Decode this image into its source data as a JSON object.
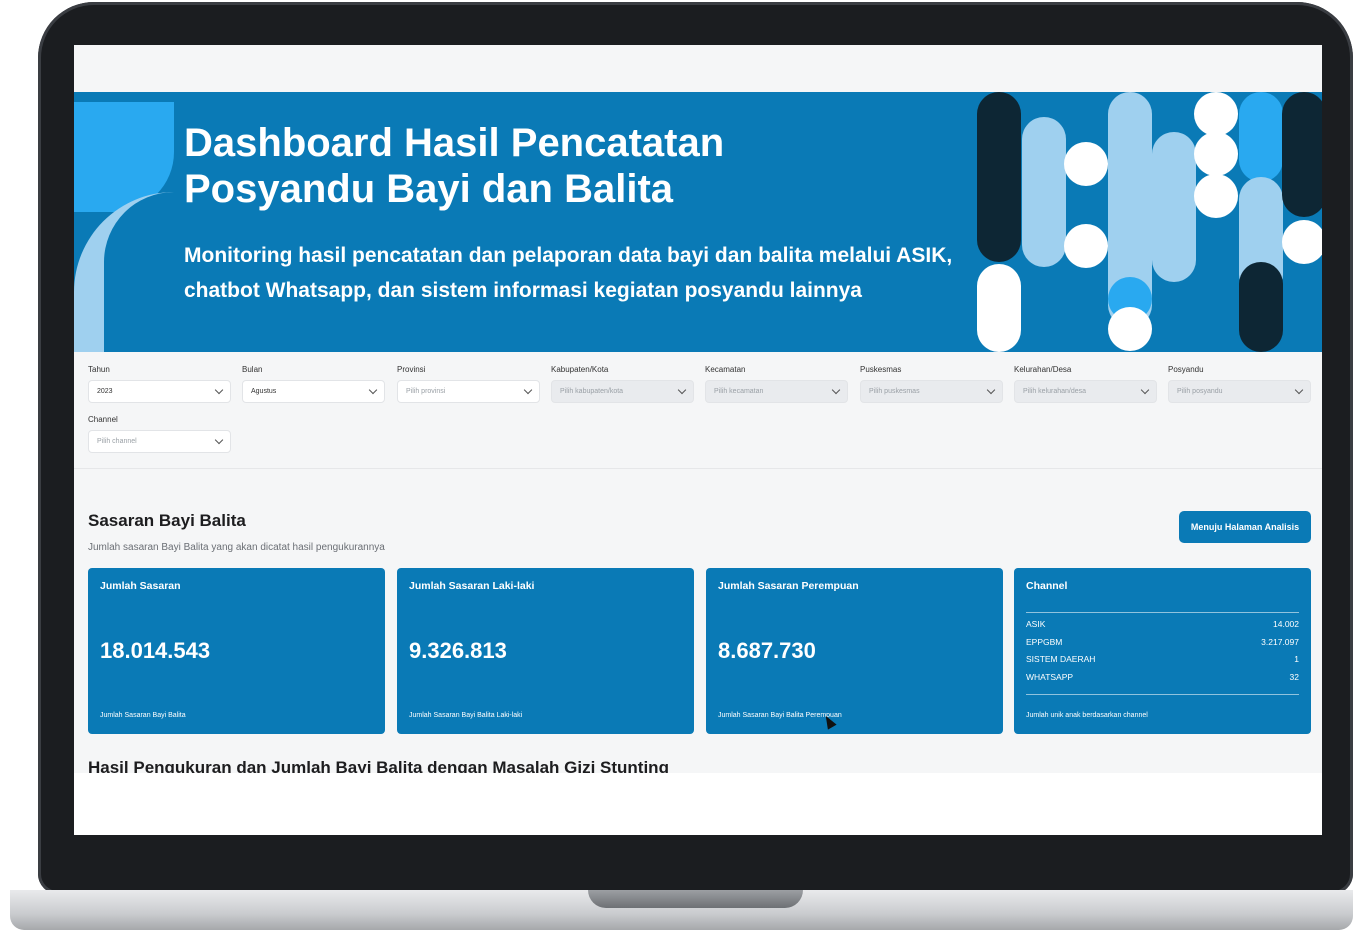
{
  "hero": {
    "title_line1": "Dashboard Hasil Pencatatan",
    "title_line2": "Posyandu Bayi dan Balita",
    "subtitle": "Monitoring hasil pencatatan dan pelaporan data bayi dan balita melalui ASIK, chatbot Whatsapp, dan sistem informasi kegiatan posyandu lainnya"
  },
  "filters": [
    {
      "label": "Tahun",
      "value": "2023",
      "placeholder": ""
    },
    {
      "label": "Bulan",
      "value": "Agustus",
      "placeholder": ""
    },
    {
      "label": "Provinsi",
      "value": "",
      "placeholder": "Pilih provinsi"
    },
    {
      "label": "Kabupaten/Kota",
      "value": "",
      "placeholder": "Pilih kabupaten/kota"
    },
    {
      "label": "Kecamatan",
      "value": "",
      "placeholder": "Pilih kecamatan"
    },
    {
      "label": "Puskesmas",
      "value": "",
      "placeholder": "Pilih puskesmas"
    },
    {
      "label": "Kelurahan/Desa",
      "value": "",
      "placeholder": "Pilih kelurahan/desa"
    },
    {
      "label": "Posyandu",
      "value": "",
      "placeholder": "Pilih posyandu"
    },
    {
      "label": "Channel",
      "value": "",
      "placeholder": "Pilih channel"
    }
  ],
  "sasaran": {
    "title": "Sasaran Bayi Balita",
    "description": "Jumlah sasaran Bayi Balita yang akan dicatat hasil pengukurannya",
    "button_label": "Menuju Halaman Analisis",
    "cards": [
      {
        "title": "Jumlah Sasaran",
        "value": "18.014.543",
        "footer": "Jumlah Sasaran Bayi Balita"
      },
      {
        "title": "Jumlah Sasaran Laki-laki",
        "value": "9.326.813",
        "footer": "Jumlah Sasaran Bayi Balita Laki-laki"
      },
      {
        "title": "Jumlah Sasaran Perempuan",
        "value": "8.687.730",
        "footer": "Jumlah Sasaran Bayi Balita Perempuan"
      }
    ],
    "channel_card": {
      "title": "Channel",
      "rows": [
        {
          "name": "ASIK",
          "value": "14.002"
        },
        {
          "name": "EPPGBM",
          "value": "3.217.097"
        },
        {
          "name": "SISTEM DAERAH",
          "value": "1"
        },
        {
          "name": "WHATSAPP",
          "value": "32"
        }
      ],
      "footer": "Jumlah unik anak berdasarkan channel"
    }
  },
  "section2": {
    "title": "Hasil Pengukuran dan Jumlah Bayi Balita dengan Masalah Gizi Stunting"
  },
  "colors": {
    "brand_blue": "#0a7ab6",
    "light_blue": "#9fd0ef",
    "sky_blue": "#29a9f0",
    "dark_navy": "#0d2634",
    "background": "#f5f6f7"
  }
}
